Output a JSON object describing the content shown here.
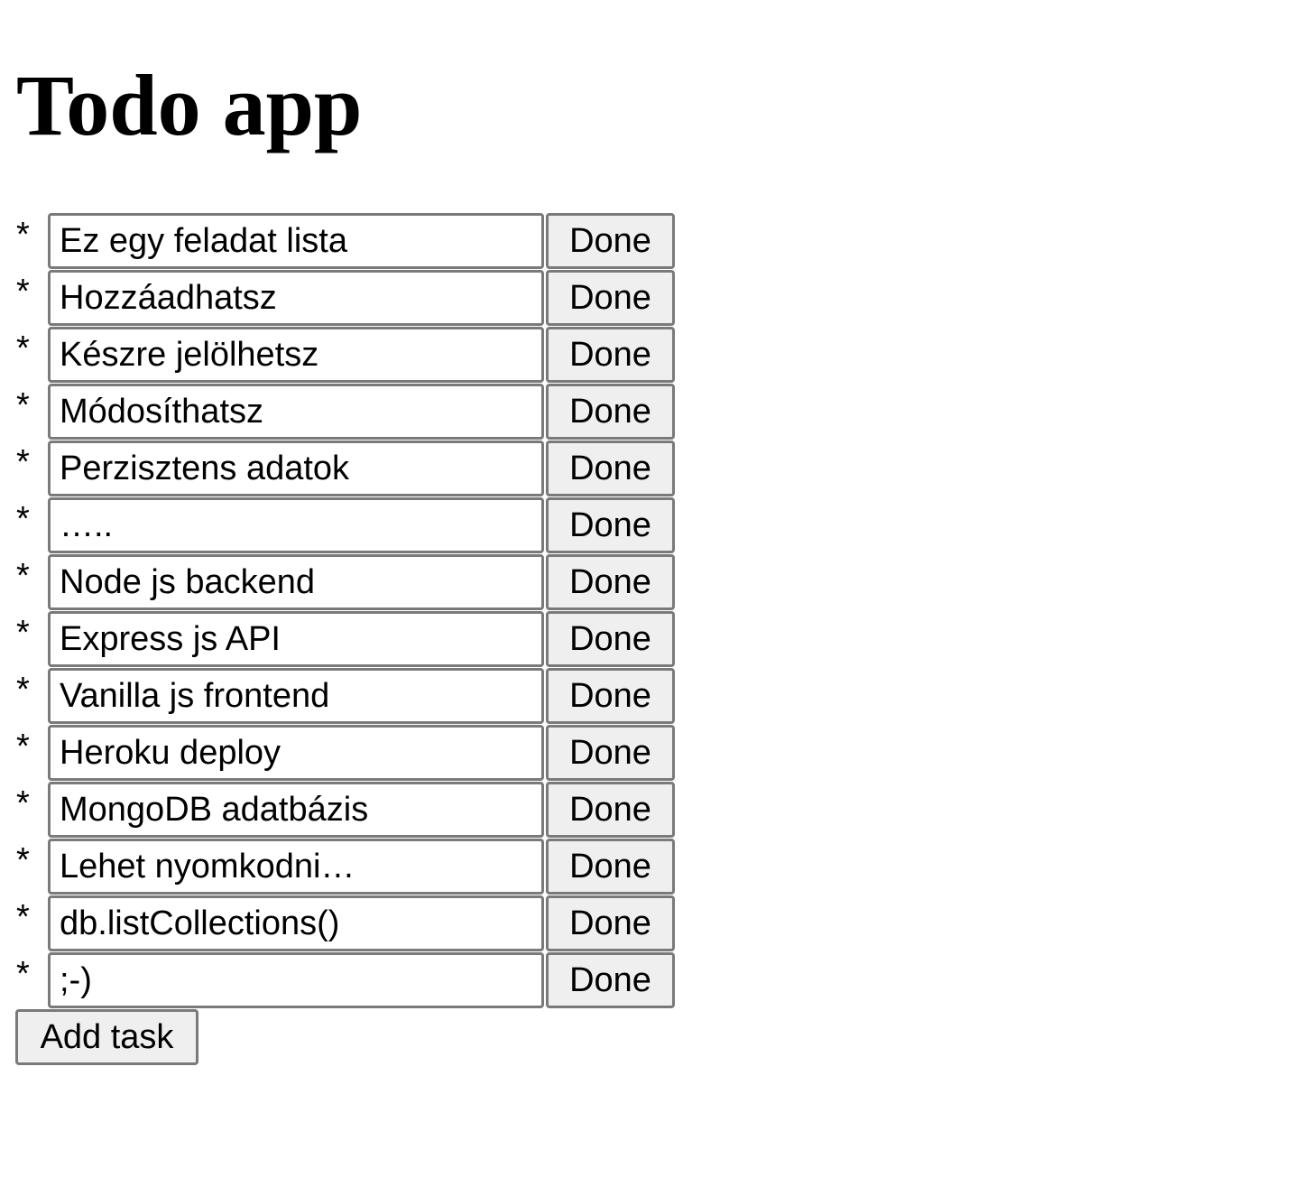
{
  "title": "Todo app",
  "bullet": "*",
  "tasks": [
    {
      "text": "Ez egy feladat lista",
      "done_label": "Done"
    },
    {
      "text": "Hozzáadhatsz",
      "done_label": "Done"
    },
    {
      "text": "Készre jelölhetsz",
      "done_label": "Done"
    },
    {
      "text": "Módosíthatsz",
      "done_label": "Done"
    },
    {
      "text": "Perzisztens adatok",
      "done_label": "Done"
    },
    {
      "text": "…..",
      "done_label": "Done"
    },
    {
      "text": "Node js backend",
      "done_label": "Done"
    },
    {
      "text": "Express js API",
      "done_label": "Done"
    },
    {
      "text": "Vanilla js frontend",
      "done_label": "Done"
    },
    {
      "text": "Heroku deploy",
      "done_label": "Done"
    },
    {
      "text": "MongoDB adatbázis",
      "done_label": "Done"
    },
    {
      "text": "Lehet nyomkodni…",
      "done_label": "Done"
    },
    {
      "text": "db.listCollections()",
      "done_label": "Done"
    },
    {
      "text": ";-)",
      "done_label": "Done"
    }
  ],
  "add_button_label": "Add task"
}
